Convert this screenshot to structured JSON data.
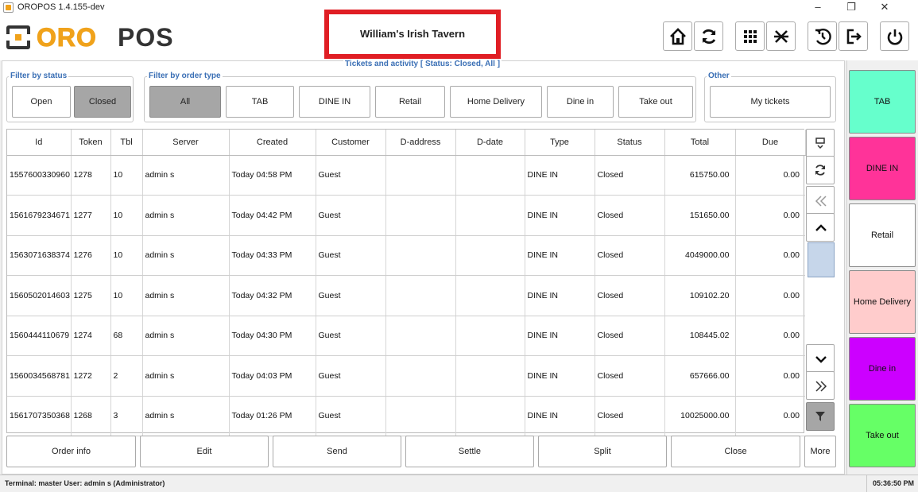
{
  "window": {
    "title": "OROPOS 1.4.155-dev",
    "minimize": "–",
    "maximize": "❐",
    "close": "✕"
  },
  "header": {
    "logo_left": "ORO",
    "logo_right": "POS",
    "store_name": "William's Irish Tavern",
    "buttons": [
      "home-icon",
      "refresh-icon",
      "grid-icon",
      "tools-icon",
      "clock-back-icon",
      "logout-icon",
      "power-icon"
    ]
  },
  "main": {
    "section_title": "Tickets and activity [ Status: Closed, All ]",
    "filter_status": {
      "legend": "Filter by status",
      "open": "Open",
      "closed": "Closed"
    },
    "filter_type": {
      "legend": "Filter by order type",
      "all": "All",
      "tab": "TAB",
      "dine_in_upper": "DINE IN",
      "retail": "Retail",
      "home_delivery": "Home Delivery",
      "dine_in": "Dine in",
      "take_out": "Take out"
    },
    "other": {
      "legend": "Other",
      "my_tickets": "My tickets"
    }
  },
  "table": {
    "columns": [
      "Id",
      "Token",
      "Tbl",
      "Server",
      "Created",
      "Customer",
      "D-address",
      "D-date",
      "Type",
      "Status",
      "Total",
      "Due"
    ],
    "rows": [
      [
        "1557600330960",
        "1278",
        "10",
        "admin s",
        "Today 04:58 PM",
        "Guest",
        "",
        "",
        "DINE IN",
        "Closed",
        "615750.00",
        "0.00"
      ],
      [
        "1561679234671",
        "1277",
        "10",
        "admin s",
        "Today 04:42 PM",
        "Guest",
        "",
        "",
        "DINE IN",
        "Closed",
        "151650.00",
        "0.00"
      ],
      [
        "1563071638374",
        "1276",
        "10",
        "admin s",
        "Today 04:33 PM",
        "Guest",
        "",
        "",
        "DINE IN",
        "Closed",
        "4049000.00",
        "0.00"
      ],
      [
        "1560502014603",
        "1275",
        "10",
        "admin s",
        "Today 04:32 PM",
        "Guest",
        "",
        "",
        "DINE IN",
        "Closed",
        "109102.20",
        "0.00"
      ],
      [
        "1560444110679",
        "1274",
        "68",
        "admin s",
        "Today 04:30 PM",
        "Guest",
        "",
        "",
        "DINE IN",
        "Closed",
        "108445.02",
        "0.00"
      ],
      [
        "1560034568781",
        "1272",
        "2",
        "admin s",
        "Today 04:03 PM",
        "Guest",
        "",
        "",
        "DINE IN",
        "Closed",
        "657666.00",
        "0.00"
      ],
      [
        "1561707350368",
        "1268",
        "3",
        "admin s",
        "Today 01:26 PM",
        "Guest",
        "",
        "",
        "DINE IN",
        "Closed",
        "10025000.00",
        "0.00"
      ]
    ]
  },
  "actions": {
    "order_info": "Order info",
    "edit": "Edit",
    "send": "Send",
    "settle": "Settle",
    "split": "Split",
    "close": "Close",
    "more": "More"
  },
  "order_types": [
    {
      "label": "TAB",
      "color": "#66ffcc"
    },
    {
      "label": "DINE IN",
      "color": "#ff3399"
    },
    {
      "label": "Retail",
      "color": "#ffffff"
    },
    {
      "label": "Home Delivery",
      "color": "#ffcccc"
    },
    {
      "label": "Dine in",
      "color": "#cc00ff"
    },
    {
      "label": "Take out",
      "color": "#66ff66"
    }
  ],
  "status": {
    "left": "Terminal: master User: admin s (Administrator)",
    "time": "05:36:50 PM"
  }
}
